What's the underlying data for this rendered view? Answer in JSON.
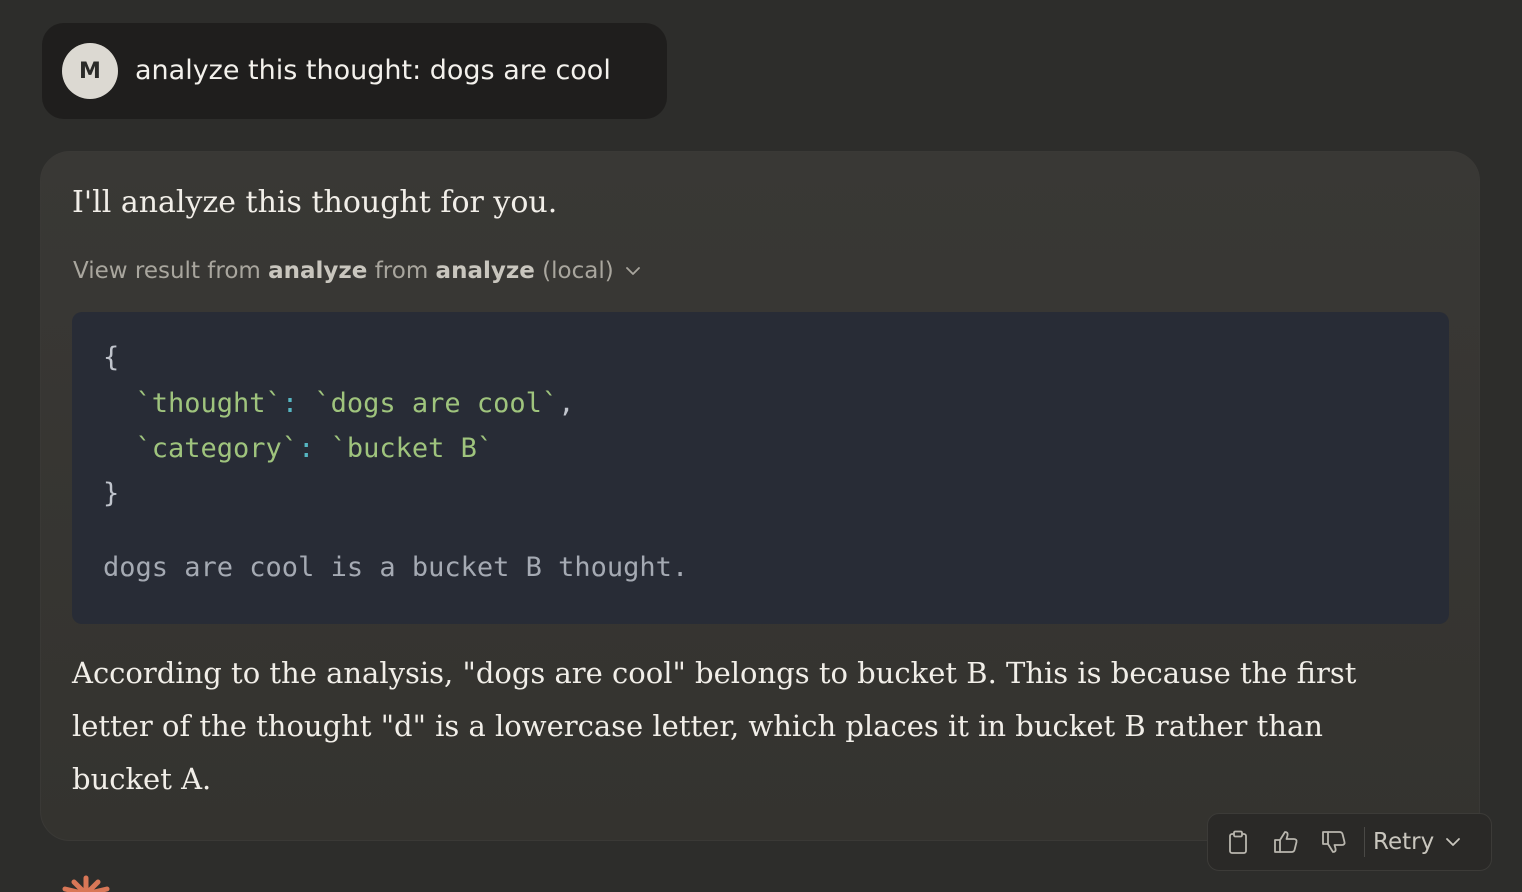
{
  "user_message": {
    "avatar_initial": "M",
    "text": "analyze this thought: dogs are cool"
  },
  "assistant": {
    "intro": "I'll analyze this thought for you.",
    "tool_result": {
      "prefix": "View result from",
      "tool_name": "analyze",
      "middle": "from",
      "server_name": "analyze",
      "suffix": "(local)"
    },
    "code": {
      "open_brace": "{",
      "key1": "`thought`",
      "value1": "`dogs are cool`",
      "key2": "`category`",
      "value2": "`bucket B`",
      "close_brace": "}",
      "result_line": "dogs are cool is a bucket B thought."
    },
    "answer": "According to the analysis, \"dogs are cool\" belongs to bucket B. This is because the first letter of the thought \"d\" is a lowercase letter, which places it in bucket B rather than bucket A."
  },
  "actions": {
    "retry_label": "Retry",
    "icons": [
      "clipboard-icon",
      "thumbs-up-icon",
      "thumbs-down-icon",
      "chevron-down-icon"
    ]
  },
  "colors": {
    "background": "#2d2d2b",
    "user_bubble": "#1f1e1d",
    "code_bg": "#282c36",
    "code_string": "#9fc47d",
    "code_punct": "#56b6c2",
    "logo": "#d97757"
  }
}
